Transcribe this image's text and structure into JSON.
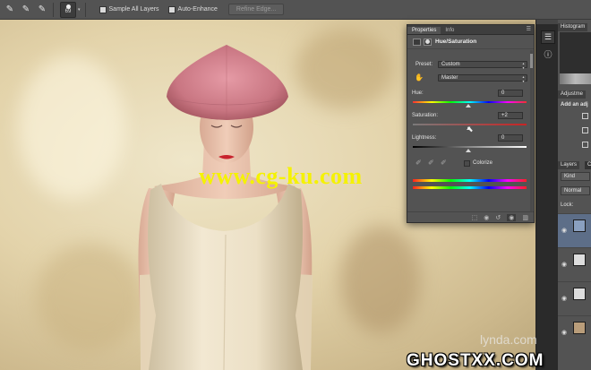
{
  "options_bar": {
    "tool_icons": [
      "quick-selection-icon",
      "add-to-selection-icon",
      "subtract-from-selection-icon"
    ],
    "brush_size": "69",
    "sample_all_layers_label": "Sample All Layers",
    "auto_enhance_label": "Auto-Enhance",
    "refine_edge_label": "Refine Edge..."
  },
  "canvas": {
    "watermark": "www.cg-ku.com"
  },
  "properties_panel": {
    "tabs": [
      "Properties",
      "Info"
    ],
    "title": "Hue/Saturation",
    "preset_label": "Preset:",
    "preset_value": "Custom",
    "channel_value": "Master",
    "hue_label": "Hue:",
    "hue_value": "0",
    "saturation_label": "Saturation:",
    "saturation_value": "+2",
    "lightness_label": "Lightness:",
    "lightness_value": "0",
    "colorize_label": "Colorize"
  },
  "right_panels": {
    "histogram_tab": "Histogram",
    "adjustments_tab": "Adjustme",
    "add_adjustment": "Add an adj",
    "layers_tab": "Layers",
    "channels_tab": "Ch",
    "kind_label": "Kind",
    "blend_mode": "Normal",
    "lock_label": "Lock:"
  },
  "branding": {
    "lynda": "lynda.com",
    "ghost": "GHOSTXX.COM"
  },
  "colors": {
    "panel": "#535353",
    "dark": "#2b2b2b",
    "accent_selected": "#5d6e88",
    "watermark": "#f5f200"
  }
}
